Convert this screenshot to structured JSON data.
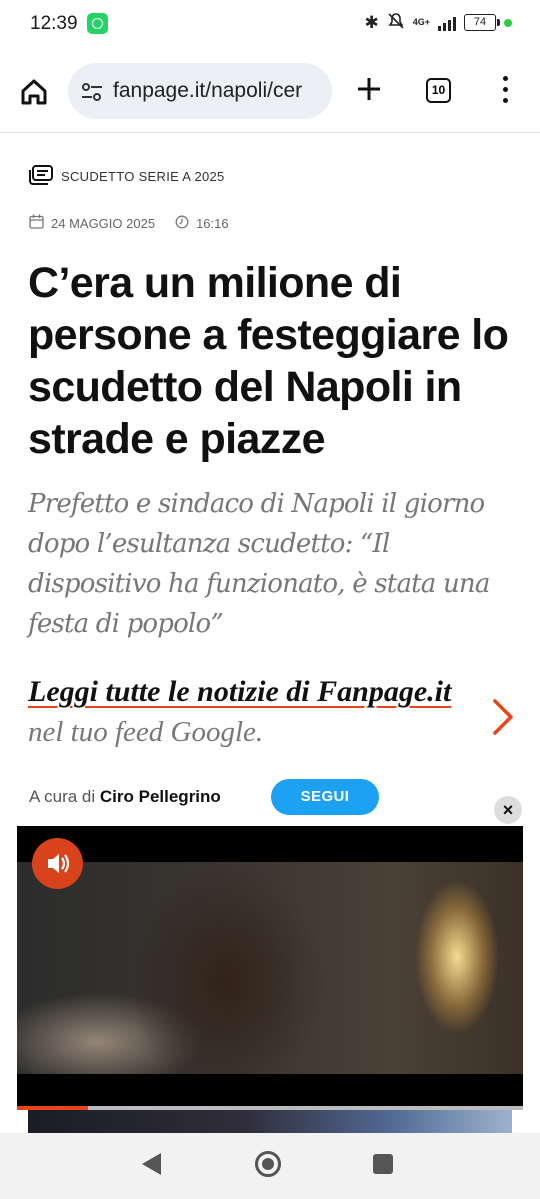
{
  "status_bar": {
    "time": "12:39",
    "network": "4G+",
    "battery": "74"
  },
  "browser": {
    "url": "fanpage.it/napoli/cer",
    "tab_count": "10"
  },
  "article": {
    "category": "SCUDETTO SERIE A 2025",
    "date": "24 MAGGIO 2025",
    "time": "16:16",
    "title": "C’era un milione di persone a festeggiare lo scudetto del Napoli in strade e piazze",
    "subtitle": "Prefetto e sindaco di Napoli il giorno dopo l’esultanza scudetto: “Il dispositivo ha funzionato, è stata una festa di popolo”",
    "google_feed_link": "Leggi tutte le notizie di Fanpage.it",
    "google_feed_rest": "nel tuo feed Google.",
    "author_prefix": "A cura di",
    "author_name": "Ciro Pellegrino",
    "follow_label": "SEGUI"
  },
  "ad": {
    "close_label": "×"
  },
  "video": {
    "progress_percent": 14
  },
  "colors": {
    "accent": "#e8441c",
    "follow_button": "#1da1f2",
    "whatsapp": "#25d366"
  },
  "icons": [
    "whatsapp-icon",
    "bluetooth-icon",
    "mute-icon",
    "signal-icon",
    "battery-icon",
    "home-icon",
    "site-settings-icon",
    "plus-icon",
    "tabs-icon",
    "menu-icon",
    "category-icon",
    "calendar-icon",
    "clock-icon",
    "chevron-right-icon",
    "volume-icon",
    "back-icon",
    "recents-icon"
  ]
}
